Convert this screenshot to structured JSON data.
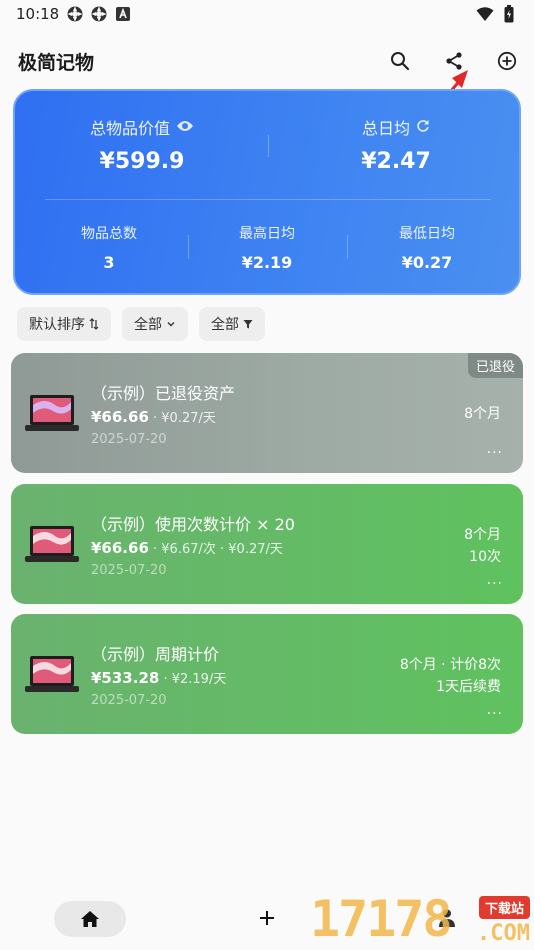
{
  "status_bar": {
    "time": "10:18"
  },
  "app_bar": {
    "title": "极简记物",
    "icons": [
      "search-icon",
      "share-icon",
      "add-circle-icon"
    ]
  },
  "summary": {
    "total_value_label": "总物品价值",
    "total_value": "¥599.9",
    "daily_avg_label": "总日均",
    "daily_avg": "¥2.47",
    "count_label": "物品总数",
    "count": "3",
    "max_daily_label": "最高日均",
    "max_daily": "¥2.19",
    "min_daily_label": "最低日均",
    "min_daily": "¥0.27"
  },
  "filters": {
    "sort_label": "默认排序",
    "category_label": "全部",
    "filter_label": "全部"
  },
  "items": [
    {
      "name": "（示例）已退役资产",
      "price": "¥66.66",
      "per_unit": " · ¥0.27/天",
      "date": "2025-07-20",
      "right_line1": "8个月",
      "right_line2": "",
      "badge": "已退役",
      "more": "···"
    },
    {
      "name": "（示例）使用次数计价 × 20",
      "price": "¥66.66",
      "per_unit": " · ¥6.67/次 · ¥0.27/天",
      "date": "2025-07-20",
      "right_line1": "8个月",
      "right_line2": "10次",
      "more": "···"
    },
    {
      "name": "（示例）周期计价",
      "price": "¥533.28",
      "per_unit": " · ¥2.19/天",
      "date": "2025-07-20",
      "right_line1": "8个月 · 计价8次",
      "right_line2": "1天后续费",
      "more": "···"
    }
  ],
  "watermark": {
    "digits": "17178",
    "tag": "下载站",
    "domain": ".COM"
  },
  "colors": {
    "card_blue": "#2f6ff2",
    "card_green": "#5fc25f",
    "card_gray": "#9eaaa4"
  }
}
